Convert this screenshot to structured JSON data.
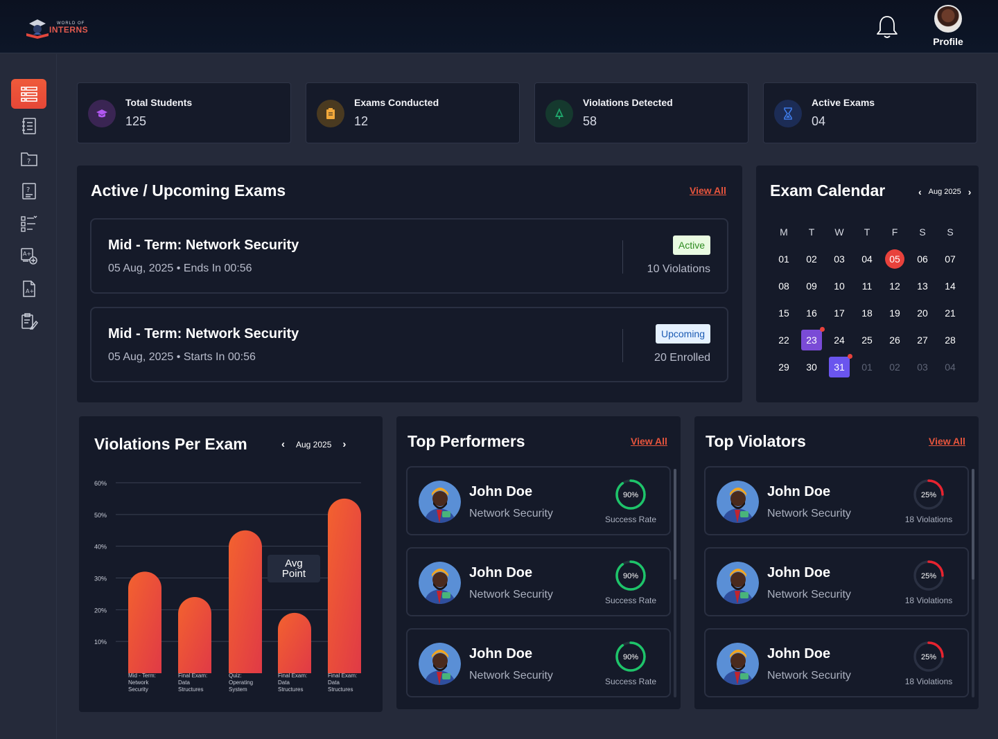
{
  "header": {
    "logo_small": "WORLD OF",
    "logo_big": "INTERNS",
    "profile_label": "Profile"
  },
  "sidebar": {
    "items": [
      {
        "icon": "dashboard-list-icon",
        "active": true
      },
      {
        "icon": "notebook-icon",
        "active": false
      },
      {
        "icon": "question-folder-icon",
        "active": false
      },
      {
        "icon": "question-doc-icon",
        "active": false
      },
      {
        "icon": "checklist-icon",
        "active": false
      },
      {
        "icon": "add-grade-icon",
        "active": false
      },
      {
        "icon": "grade-doc-icon",
        "active": false
      },
      {
        "icon": "edit-clipboard-icon",
        "active": false
      }
    ]
  },
  "stats": [
    {
      "title": "Total Students",
      "value": "125",
      "icon": "graduation-cap-icon",
      "color": "#a64de0"
    },
    {
      "title": "Exams Conducted",
      "value": "12",
      "icon": "clipboard-icon",
      "color": "#f2a93b"
    },
    {
      "title": "Violations Detected",
      "value": "58",
      "icon": "tree-icon",
      "color": "#1fa56b"
    },
    {
      "title": "Active Exams",
      "value": "04",
      "icon": "hourglass-icon",
      "color": "#3f7be8"
    }
  ],
  "exams": {
    "title": "Active / Upcoming Exams",
    "view_all": "View All",
    "items": [
      {
        "title": "Mid - Term: Network Security",
        "date": "05 Aug, 2025",
        "timing": "Ends In 00:56",
        "status": "Active",
        "meta": "10 Violations"
      },
      {
        "title": "Mid - Term: Network Security",
        "date": "05 Aug, 2025",
        "timing": "Starts In 00:56",
        "status": "Upcoming",
        "meta": "20 Enrolled"
      }
    ]
  },
  "calendar": {
    "title": "Exam Calendar",
    "month": "Aug 2025",
    "weekdays": [
      "M",
      "T",
      "W",
      "T",
      "F",
      "S",
      "S"
    ],
    "days": [
      [
        "01",
        "02",
        "03",
        "04",
        "05",
        "06",
        "07"
      ],
      [
        "08",
        "09",
        "10",
        "11",
        "12",
        "13",
        "14"
      ],
      [
        "15",
        "16",
        "17",
        "18",
        "19",
        "20",
        "21"
      ],
      [
        "22",
        "23",
        "24",
        "25",
        "26",
        "27",
        "28"
      ],
      [
        "29",
        "30",
        "31",
        "01",
        "02",
        "03",
        "04"
      ]
    ]
  },
  "violations_chart": {
    "title": "Violations Per Exam",
    "month": "Aug 2025",
    "tooltip": "Avg Point"
  },
  "chart_data": {
    "type": "bar",
    "title": "Violations Per Exam",
    "categories": [
      [
        "Mid - Term:",
        "Network",
        "Security"
      ],
      [
        "Final Exam:",
        "Data",
        "Structures"
      ],
      [
        "Quiz:",
        "Operating",
        "System"
      ],
      [
        "Final Exam:",
        "Data",
        "Structures"
      ],
      [
        "Final Exam:",
        "Data",
        "Structures"
      ]
    ],
    "values": [
      32,
      24,
      45,
      19,
      55
    ],
    "yticks": [
      "60%",
      "50%",
      "40%",
      "30%",
      "20%",
      "10%"
    ],
    "ylim": [
      0,
      60
    ],
    "grid": true
  },
  "top_performers": {
    "title": "Top Performers",
    "view_all": "View All",
    "items": [
      {
        "name": "John Doe",
        "subject": "Network Security",
        "value": "90%",
        "label": "Success Rate",
        "pct": 0.9
      },
      {
        "name": "John Doe",
        "subject": "Network Security",
        "value": "90%",
        "label": "Success Rate",
        "pct": 0.9
      },
      {
        "name": "John Doe",
        "subject": "Network Security",
        "value": "90%",
        "label": "Success Rate",
        "pct": 0.9
      }
    ]
  },
  "top_violators": {
    "title": "Top Violators",
    "view_all": "View All",
    "items": [
      {
        "name": "John Doe",
        "subject": "Network Security",
        "value": "25%",
        "label": "18 Violations",
        "pct": 0.25
      },
      {
        "name": "John Doe",
        "subject": "Network Security",
        "value": "25%",
        "label": "18 Violations",
        "pct": 0.25
      },
      {
        "name": "John Doe",
        "subject": "Network Security",
        "value": "25%",
        "label": "18 Violations",
        "pct": 0.25
      }
    ]
  }
}
